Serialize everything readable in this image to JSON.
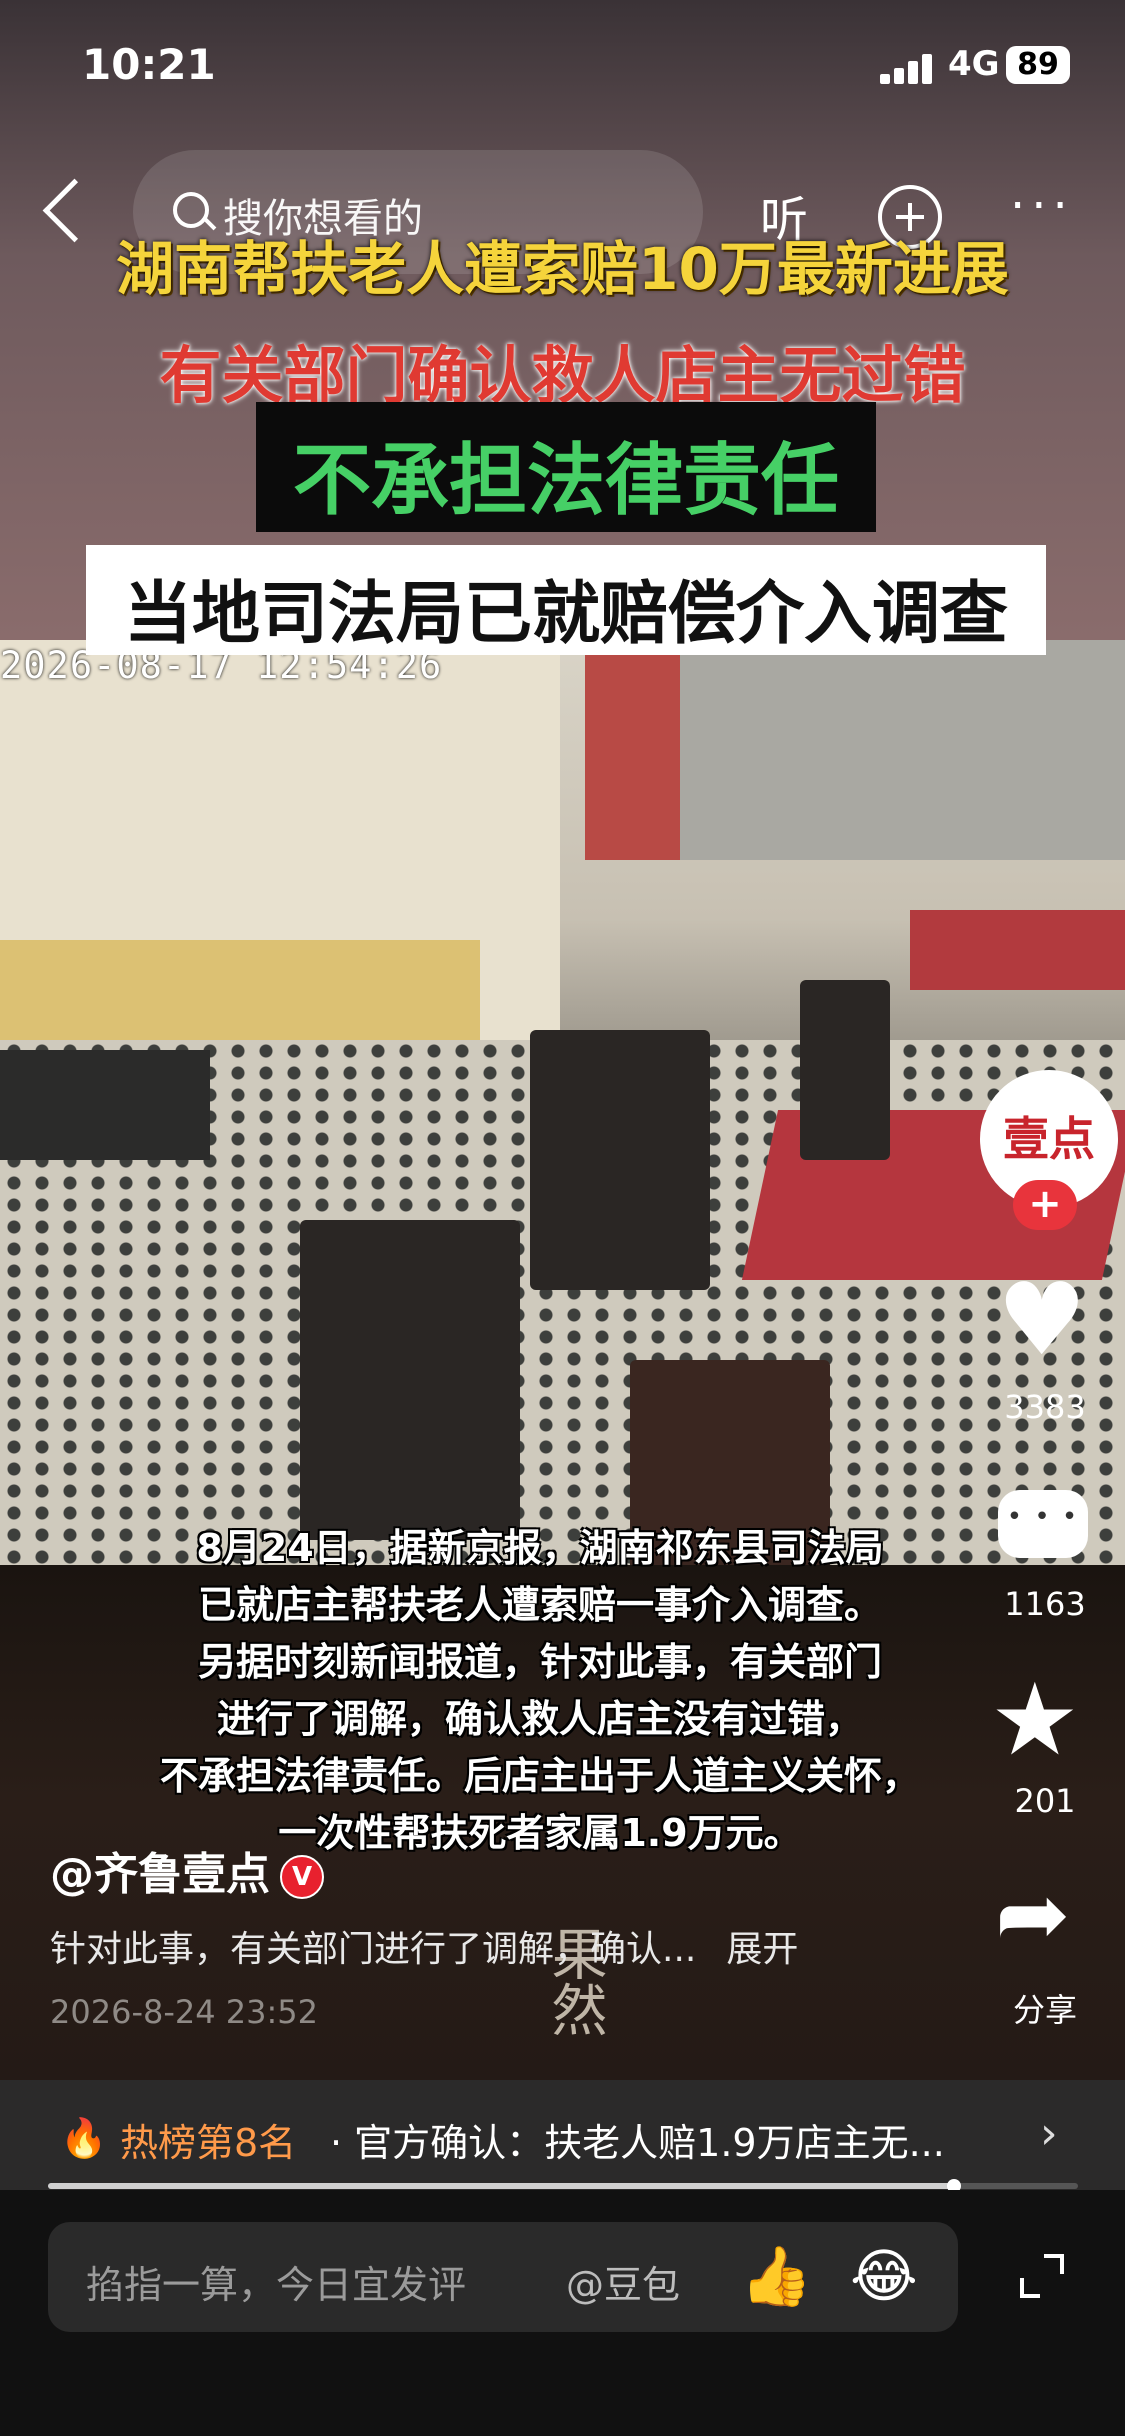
{
  "status_bar": {
    "time": "10:21",
    "network": "4G",
    "battery": "89"
  },
  "nav": {
    "search_placeholder": "搜你想看的",
    "listen_label": "听",
    "more_label": "···"
  },
  "video": {
    "headline_yellow": "湖南帮扶老人遭索赔10万最新进展",
    "headline_red": "有关部门确认救人店主无过错",
    "headline_green": "不承担法律责任",
    "headline_white": "当地司法局已就赔偿介入调查",
    "timestamp": "2026-08-17  12:54:26",
    "caption_lines": [
      "8月24日，据新京报，湖南祁东县司法局",
      "已就店主帮扶老人遭索赔一事介入调查。",
      "另据时刻新闻报道，针对此事，有关部门",
      "进行了调解，确认救人店主没有过错，",
      "不承担法律责任。后店主出于人道主义关怀，",
      "一次性帮扶死者家属1.9万元。"
    ],
    "watermark": "果然",
    "progress": 0.88
  },
  "post": {
    "author": "@齐鲁壹点",
    "verified_badge": "V",
    "description": "针对此事，有关部门进行了调解，确认...",
    "expand_label": "展开",
    "date": "2026-8-24 23:52"
  },
  "side_rail": {
    "avatar_text": "壹点",
    "follow_label": "+",
    "likes": "3383",
    "comments": "1163",
    "favorites": "201",
    "share_label": "分享"
  },
  "hot": {
    "rank": "热榜第8名",
    "text": "· 官方确认：扶老人赔1.9万店主无...",
    "chevron": "›"
  },
  "comment_bar": {
    "placeholder": "掐指一算，今日宜发评",
    "mention": "@豆包",
    "emoji_1": "👍",
    "emoji_2": "😂"
  },
  "colors": {
    "accent_red": "#e8343c",
    "yellow": "#f5d43b",
    "green": "#46d066",
    "hot_orange": "#ff9a4a"
  }
}
